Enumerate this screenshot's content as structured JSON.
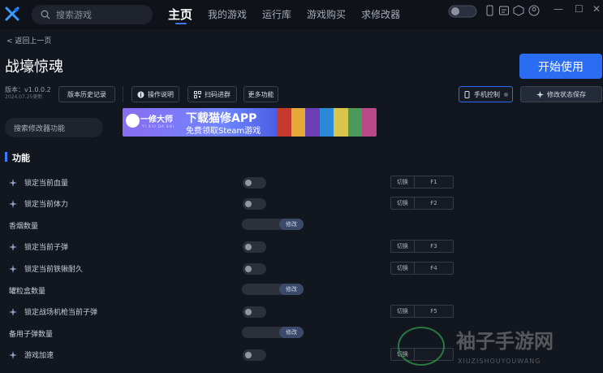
{
  "topbar": {
    "search_placeholder": "搜索游戏",
    "tabs": [
      {
        "label": "主页",
        "active": true
      },
      {
        "label": "我的游戏"
      },
      {
        "label": "运行库"
      },
      {
        "label": "游戏购买"
      },
      {
        "label": "求修改器"
      }
    ],
    "icons": [
      "toggle-icon",
      "phone-icon",
      "window-icon",
      "cube-icon",
      "user-icon"
    ],
    "window_buttons": [
      "minimize",
      "maximize",
      "close"
    ]
  },
  "page": {
    "back": "< 返回上一页",
    "title": "战壕惊魂",
    "version_label": "版本：v1.0.0.2",
    "version_date": "2024.07.25更新",
    "buttons": {
      "history": "版本历史记录",
      "guide": "操作说明",
      "scan": "扫码进群",
      "more": "更多功能",
      "phone_control": "手机控制",
      "save_state": "修改状态保存",
      "start": "开始使用",
      "search_mod": "搜索修改器功能"
    },
    "banner": {
      "brand": "一修大师",
      "pinyin": "YI XIU DA SHI",
      "headline": "下载猫修APP",
      "sub": "免费领取Steam游戏"
    }
  },
  "section": {
    "title": "功能"
  },
  "features": [
    {
      "label": "锁定当前血量",
      "type": "toggle",
      "switch": "切换",
      "key": "F1"
    },
    {
      "label": "锁定当前体力",
      "type": "toggle",
      "switch": "切换",
      "key": "F2"
    },
    {
      "label": "香烟数量",
      "type": "slider",
      "mod": "修改"
    },
    {
      "label": "锁定当前子弹",
      "type": "toggle",
      "switch": "切换",
      "key": "F3"
    },
    {
      "label": "锁定当前铁锹耐久",
      "type": "toggle",
      "switch": "切换",
      "key": "F4"
    },
    {
      "label": "罐粒盒数量",
      "type": "slider",
      "mod": "修改"
    },
    {
      "label": "锁定战场机枪当前子弹",
      "type": "toggle",
      "switch": "切换",
      "key": "F5"
    },
    {
      "label": "备用子弹数量",
      "type": "slider",
      "mod": "修改"
    },
    {
      "label": "游戏加速",
      "type": "toggle",
      "switch": "切换",
      "key": ""
    }
  ],
  "watermark": {
    "title": "袖子手游网",
    "url": "XIUZISHOUYOUWANG"
  },
  "colors": {
    "accent": "#2a6cf2",
    "background": "#12161f"
  }
}
